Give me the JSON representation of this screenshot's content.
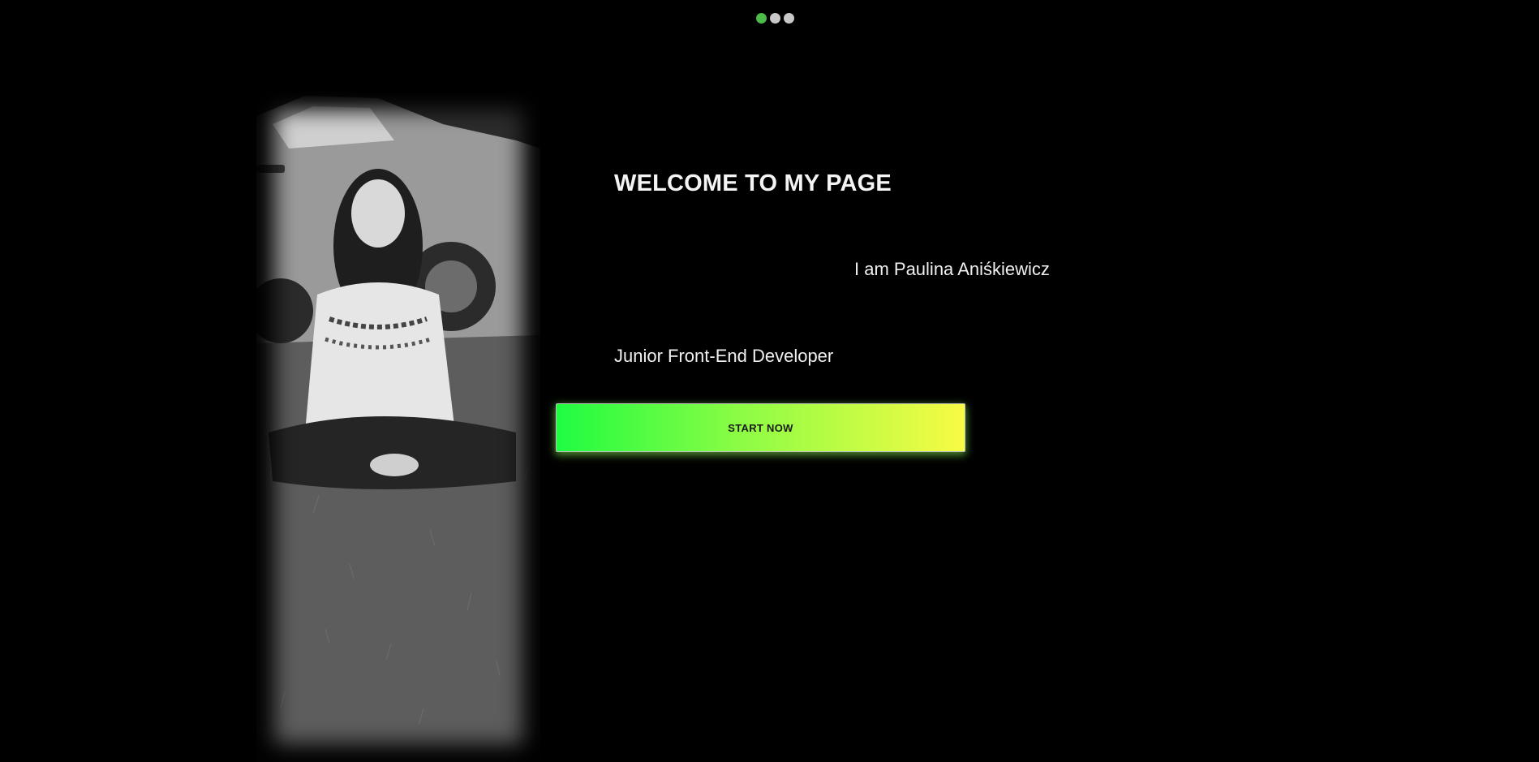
{
  "pager": {
    "dots": [
      {
        "label": "slide-1",
        "active": true
      },
      {
        "label": "slide-2",
        "active": false
      },
      {
        "label": "slide-3",
        "active": false
      }
    ],
    "active_color": "#4cbb4a",
    "inactive_color": "#c8c8c8"
  },
  "hero": {
    "title": "WELCOME TO MY PAGE",
    "intro": "I am Paulina Aniśkiewicz",
    "role": "Junior Front-End Developer",
    "cta_label": "START NOW"
  },
  "photo": {
    "description_icon": "profile-photo"
  },
  "colors": {
    "background": "#000000",
    "text": "#f0f0f0",
    "cta_gradient_start": "#1ffc42",
    "cta_gradient_end": "#f8fb44"
  }
}
